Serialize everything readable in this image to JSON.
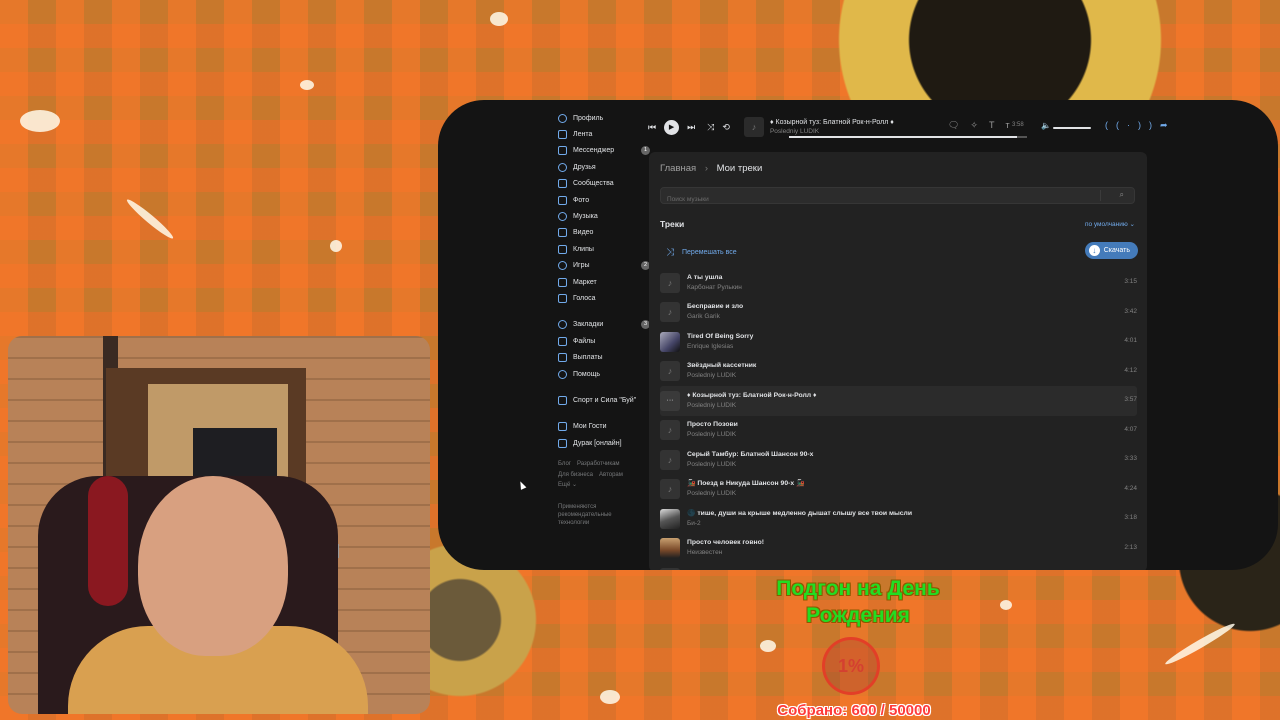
{
  "sidebar": {
    "items": [
      {
        "label": "Профиль",
        "icon": "profile-icon",
        "badge": ""
      },
      {
        "label": "Лента",
        "icon": "feed-icon",
        "badge": ""
      },
      {
        "label": "Мессенджер",
        "icon": "messenger-icon",
        "badge": "1"
      },
      {
        "label": "Друзья",
        "icon": "friends-icon",
        "badge": ""
      },
      {
        "label": "Сообщества",
        "icon": "communities-icon",
        "badge": ""
      },
      {
        "label": "Фото",
        "icon": "photo-icon",
        "badge": ""
      },
      {
        "label": "Музыка",
        "icon": "music-icon",
        "badge": ""
      },
      {
        "label": "Видео",
        "icon": "video-icon",
        "badge": ""
      },
      {
        "label": "Клипы",
        "icon": "clips-icon",
        "badge": ""
      },
      {
        "label": "Игры",
        "icon": "games-icon",
        "badge": "2"
      },
      {
        "label": "Маркет",
        "icon": "market-icon",
        "badge": ""
      },
      {
        "label": "Голоса",
        "icon": "votes-icon",
        "badge": ""
      }
    ],
    "items2": [
      {
        "label": "Закладки",
        "icon": "bookmarks-icon",
        "badge": "3"
      },
      {
        "label": "Файлы",
        "icon": "files-icon",
        "badge": ""
      },
      {
        "label": "Выплаты",
        "icon": "payouts-icon",
        "badge": ""
      },
      {
        "label": "Помощь",
        "icon": "help-icon",
        "badge": ""
      }
    ],
    "community": "Спорт и Сила \"Буй\"",
    "apps": [
      "Мои Гости",
      "Дурак [онлайн]"
    ],
    "footer": {
      "blog": "Блог",
      "devs": "Разработчикам",
      "business": "Для бизнеса",
      "authors": "Авторам",
      "more": "Ещё ⌄"
    },
    "tech": "Применяются рекомендательные технологии"
  },
  "player": {
    "title": "♦ Козырной туз: Блатной Рок-н-Ролл ♦",
    "artist": "Posledniy LUDIK",
    "time": "3:58",
    "progress": 0.96
  },
  "main": {
    "breadcrumb_home": "Главная",
    "breadcrumb_sep": "›",
    "breadcrumb_current": "Мои треки",
    "search_placeholder": "Поиск музыки",
    "tracks_heading": "Треки",
    "sort_label": "по умолчанию ⌄",
    "shuffle_label": "Перемешать все",
    "download_label": "Скачать"
  },
  "tracks": [
    {
      "title": "А ты ушла",
      "artist": "Карбонат Рулькин",
      "duration": "3:15"
    },
    {
      "title": "Бесправие и зло",
      "artist": "Garik Garik",
      "duration": "3:42"
    },
    {
      "title": "Tired Of Being Sorry",
      "artist": "Enrique Iglesias",
      "duration": "4:01"
    },
    {
      "title": "Звёздный кассетник",
      "artist": "Posledniy LUDIK",
      "duration": "4:12"
    },
    {
      "title": "♦ Козырной туз: Блатной Рок-н-Ролл ♦",
      "artist": "Posledniy LUDIK",
      "duration": "3:57"
    },
    {
      "title": "Просто Позови",
      "artist": "Posledniy LUDIK",
      "duration": "4:07"
    },
    {
      "title": "Серый Тамбур: Блатной Шансон 90-х",
      "artist": "Posledniy LUDIK",
      "duration": "3:33"
    },
    {
      "title": "🚂 Поезд в Никуда Шансон 90-х 🚂",
      "artist": "Posledniy LUDIK",
      "duration": "4:24"
    },
    {
      "title": "🌑 тише, души на крыше медленно дышат слышу все твои мысли",
      "artist": "Би-2",
      "duration": "3:18"
    },
    {
      "title": "Просто человек говно!",
      "artist": "Неизвестен",
      "duration": "2:13"
    },
    {
      "title": "Я не буду ждать тебя [Я не стану ждать на берегу]",
      "artist": "",
      "duration": ""
    }
  ],
  "overlay": {
    "goal_title": "Подгон на День Рождения",
    "percent": "1%",
    "collected": "Собрано: 600 / 50000"
  }
}
